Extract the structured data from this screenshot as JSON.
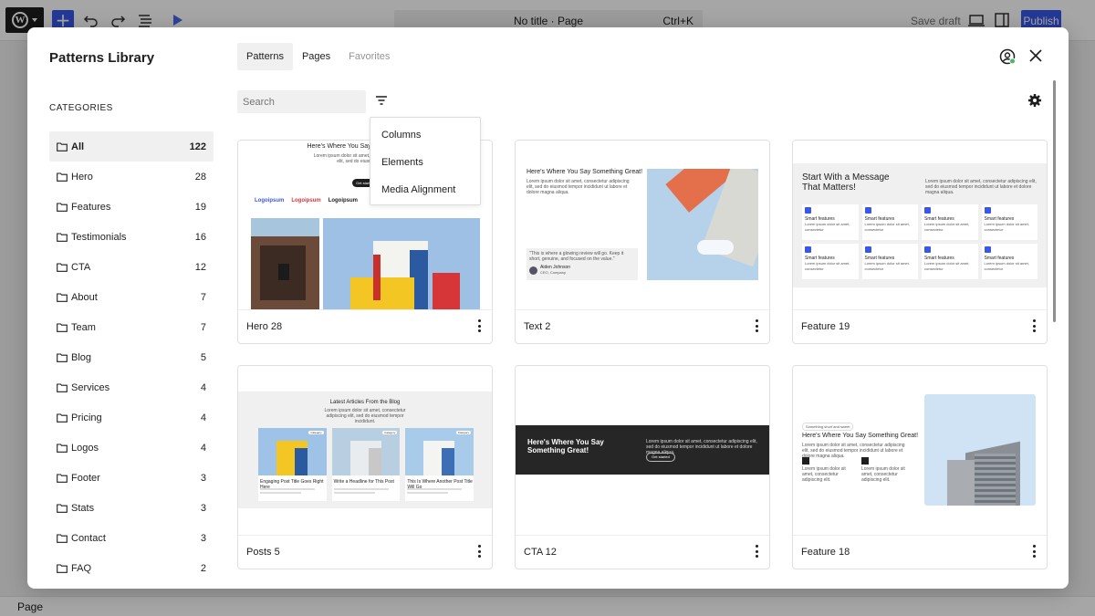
{
  "editor": {
    "doc_title": "No title · Page",
    "shortcut": "Ctrl+K",
    "save_draft": "Save draft",
    "publish": "Publish",
    "footer": "Page"
  },
  "modal": {
    "title": "Patterns Library",
    "tabs": [
      {
        "label": "Patterns",
        "state": "active"
      },
      {
        "label": "Pages",
        "state": "normal"
      },
      {
        "label": "Favorites",
        "state": "disabled"
      }
    ],
    "search_placeholder": "Search",
    "categories_heading": "Categories",
    "categories": [
      {
        "name": "All",
        "count": "122"
      },
      {
        "name": "Hero",
        "count": "28"
      },
      {
        "name": "Features",
        "count": "19"
      },
      {
        "name": "Testimonials",
        "count": "16"
      },
      {
        "name": "CTA",
        "count": "12"
      },
      {
        "name": "About",
        "count": "7"
      },
      {
        "name": "Team",
        "count": "7"
      },
      {
        "name": "Blog",
        "count": "5"
      },
      {
        "name": "Services",
        "count": "4"
      },
      {
        "name": "Pricing",
        "count": "4"
      },
      {
        "name": "Logos",
        "count": "4"
      },
      {
        "name": "Footer",
        "count": "3"
      },
      {
        "name": "Stats",
        "count": "3"
      },
      {
        "name": "Contact",
        "count": "3"
      },
      {
        "name": "FAQ",
        "count": "2"
      }
    ],
    "filter_menu": [
      "Columns",
      "Elements",
      "Media Alignment"
    ],
    "cards": [
      {
        "label": "Hero 28"
      },
      {
        "label": "Text 2"
      },
      {
        "label": "Feature 19"
      },
      {
        "label": "Posts 5"
      },
      {
        "label": "CTA 12"
      },
      {
        "label": "Feature 18"
      }
    ]
  },
  "previews": {
    "hero": {
      "title": "Here's Where You Say Something Great!",
      "body": "Lorem ipsum dolor sit amet, consectetur adipiscing elit, sed do eiusmod tempor",
      "button": "Get started",
      "logos": [
        "Logoipsum",
        "Logoipsum",
        "Logoipsum"
      ]
    },
    "text": {
      "title": "Here's Where You Say Something Great!",
      "body": "Lorem ipsum dolor sit amet, consectetur adipiscing elit, sed do eiusmod tempor incididunt ut labore et dolore magna aliqua.",
      "quote": "\"This is where a glowing review will go. Keep it short, genuine, and focused on the value.\"",
      "author": "Aiden Johnson",
      "role": "CEO, Company"
    },
    "feature19": {
      "title": "Start With a Message That Matters!",
      "body": "Lorem ipsum dolor sit amet, consectetur adipiscing elit, sed do eiusmod tempor incididunt ut labore et dolore magna aliqua.",
      "item": "Smart features",
      "item_body": "Lorem ipsum dolor sit amet, consectetur"
    },
    "posts": {
      "title": "Latest Articles From the Blog",
      "body": "Lorem ipsum dolor sit amet, consectetur adipiscing elit, sed do eiusmod tempor incididunt.",
      "badge": "Category",
      "posts": [
        "Engaging Post Title Goes Right Here",
        "Write a Headline for This Post",
        "This Is Where Another Post Title Will Go"
      ]
    },
    "cta": {
      "title": "Here's Where You Say Something Great!",
      "body": "Lorem ipsum dolor sit amet, consectetur adipiscing elit, sed do eiusmod tempor incididunt ut labore et dolore magna aliqua.",
      "button": "Get started"
    },
    "feature18": {
      "eyebrow": "Something short and sweet",
      "title": "Here's Where You Say Something Great!",
      "body": "Lorem ipsum dolor sit amet, consectetur adipiscing elit, sed do eiusmod tempor incididunt ut labore et dolore magna aliqua.",
      "item_body": "Lorem ipsum dolor sit amet, consectetur adipiscing elit."
    }
  }
}
